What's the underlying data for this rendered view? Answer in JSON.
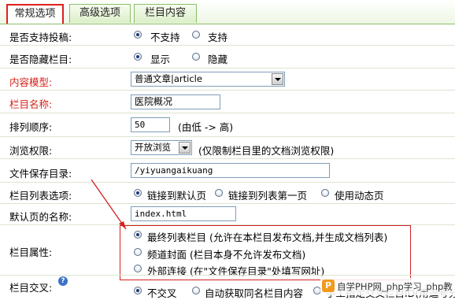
{
  "tabs": [
    {
      "label": "常规选项",
      "active": true
    },
    {
      "label": "高级选项",
      "active": false
    },
    {
      "label": "栏目内容",
      "active": false
    }
  ],
  "form": {
    "submission": {
      "label": "是否支持投稿:",
      "options": [
        "不支持",
        "支持"
      ],
      "selected": 0
    },
    "hidden": {
      "label": "是否隐藏栏目:",
      "options": [
        "显示",
        "隐藏"
      ],
      "selected": 0
    },
    "content_model": {
      "label": "内容模型:",
      "value": "普通文章|article"
    },
    "name": {
      "label": "栏目名称:",
      "value": "医院概况"
    },
    "order": {
      "label": "排列顺序:",
      "value": "50",
      "hint": "(由低 -> 高)"
    },
    "browse": {
      "label": "浏览权限:",
      "value": "开放浏览",
      "hint": "(仅限制栏目里的文档浏览权限)"
    },
    "save_dir": {
      "label": "文件保存目录:",
      "value": "/yiyuangaikuang"
    },
    "list_options": {
      "label": "栏目列表选项:",
      "options": [
        "链接到默认页",
        "链接到列表第一页",
        "使用动态页"
      ],
      "selected": 0
    },
    "default_page": {
      "label": "默认页的名称:",
      "value": "index.html"
    },
    "attribute": {
      "label": "栏目属性:",
      "options": [
        "最终列表栏目 (允许在本栏目发布文档,并生成文档列表)",
        "频道封面 (栏目本身不允许发布文档)",
        "外部连接 (在\"文件保存目录\"处填写网址)"
      ],
      "selected": 0
    },
    "cross": {
      "label": "栏目交叉:",
      "options": [
        "不交叉",
        "自动获取同名栏目内容",
        "手工指定交叉栏目ID(用逗号分开)"
      ],
      "selected": 0
    }
  },
  "watermark": {
    "logo": "P",
    "text": "自学PHP网_php学习_php教"
  },
  "colors": {
    "accent_red": "#d42020",
    "tab_green": "#8bbf6a",
    "required_label": "#d4231a"
  }
}
